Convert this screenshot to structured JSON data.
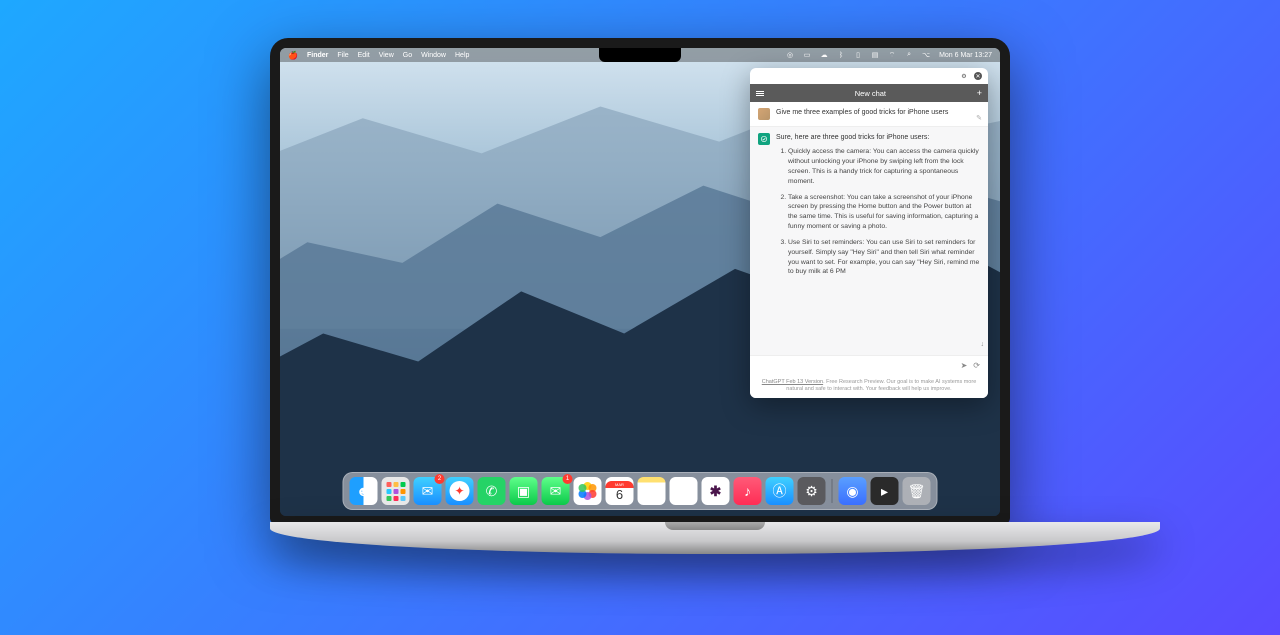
{
  "menubar": {
    "app": "Finder",
    "items": [
      "File",
      "Edit",
      "View",
      "Go",
      "Window",
      "Help"
    ],
    "datetime": "Mon 6 Mar 13:27"
  },
  "chat": {
    "titlebar": {
      "gear": "⚙",
      "close": "✕"
    },
    "header": {
      "title": "New chat",
      "plus": "+"
    },
    "user_message": "Give me three examples of good tricks for iPhone users",
    "ai_intro": "Sure, here are three good tricks for iPhone users:",
    "ai_points": [
      "Quickly access the camera: You can access the camera quickly without unlocking your iPhone by swiping left from the lock screen. This is a handy trick for capturing a spontaneous moment.",
      "Take a screenshot: You can take a screenshot of your iPhone screen by pressing the Home button and the Power button at the same time. This is useful for saving information, capturing a funny moment or saving a photo.",
      "Use Siri to set reminders: You can use Siri to set reminders for yourself. Simply say \"Hey Siri\" and then tell Siri what reminder you want to set. For example, you can say \"Hey Siri, remind me to buy milk at 6 PM"
    ],
    "input_placeholder": "",
    "footer_link": "ChatGPT Feb 13 Version",
    "footer_text": ". Free Research Preview. Our goal is to make AI systems more natural and safe to interact with. Your feedback will help us improve."
  },
  "dock": {
    "mail_badge": "2",
    "messages_badge": "1",
    "calendar_label": "MAR",
    "calendar_day": "6"
  }
}
